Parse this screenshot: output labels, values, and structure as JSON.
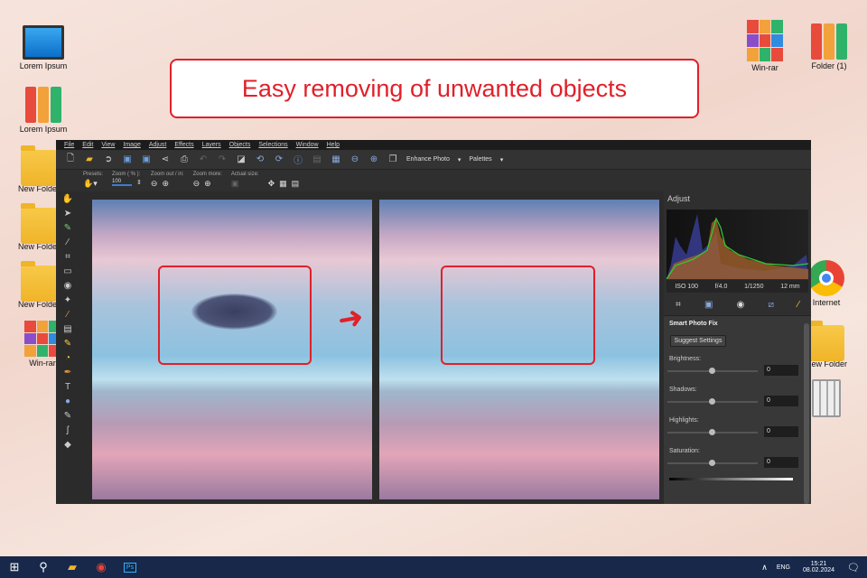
{
  "banner": {
    "text": "Easy removing of unwanted objects"
  },
  "desktop_left": [
    "Lorem Ipsum",
    "Lorem Ipsum",
    "New Folder",
    "New Folder",
    "New Folder",
    "Win-rar"
  ],
  "desktop_right": {
    "winrar": "Win-rar",
    "folder1": "Folder (1)",
    "internet": "Internet",
    "newfolder": "New Folder"
  },
  "menu": [
    "File",
    "Edit",
    "View",
    "Image",
    "Adjust",
    "Effects",
    "Layers",
    "Objects",
    "Selections",
    "Window",
    "Help"
  ],
  "toolbar": {
    "enhance": "Enhance Photo",
    "palettes": "Palettes"
  },
  "sub": {
    "presets": "Presets:",
    "zoom": "Zoom ( % ):",
    "zoom_value": "100",
    "zoomout": "Zoom out / in:",
    "zoommore": "Zoom more:",
    "actual": "Actual size:"
  },
  "panel": {
    "title": "Adjust",
    "exif": [
      "ISO 100",
      "f/4.0",
      "1/1250",
      "12 mm"
    ],
    "section": "Smart Photo Fix",
    "suggest": "Suggest Settings",
    "sliders": [
      {
        "label": "Brightness:",
        "value": "0"
      },
      {
        "label": "Shadows:",
        "value": "0"
      },
      {
        "label": "Highlights:",
        "value": "0"
      },
      {
        "label": "Saturation:",
        "value": "0"
      }
    ]
  },
  "taskbar": {
    "lang": "ENG",
    "time": "15:21",
    "date": "08.02.2024"
  }
}
